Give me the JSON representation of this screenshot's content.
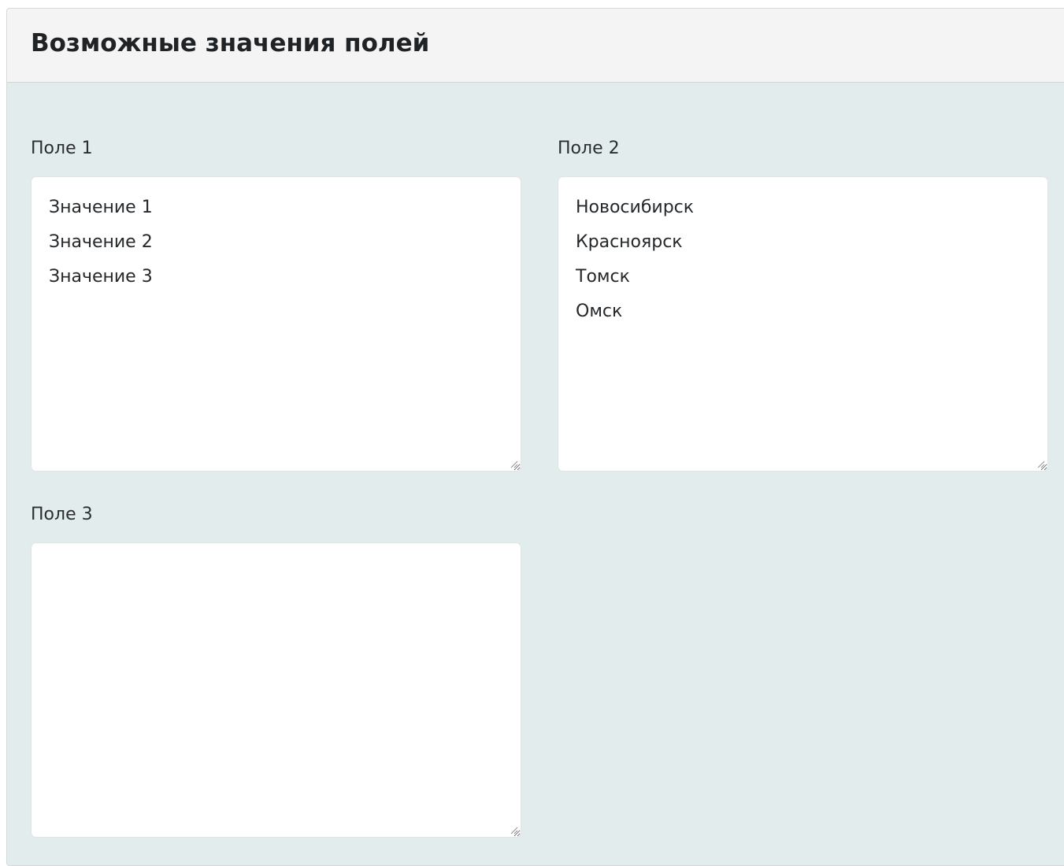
{
  "panel": {
    "title": "Возможные значения полей"
  },
  "fields": [
    {
      "label": "Поле 1",
      "value": "Значение 1\nЗначение 2\nЗначение 3"
    },
    {
      "label": "Поле 2",
      "value": "Новосибирск\nКрасноярск\nТомск\nОмск"
    },
    {
      "label": "Поле 3",
      "value": ""
    }
  ],
  "icons": {
    "resize": "resize-grip-icon"
  },
  "colors": {
    "panel_background": "#e3ecec",
    "header_background": "#f4f4f4",
    "input_background": "#ffffff"
  }
}
